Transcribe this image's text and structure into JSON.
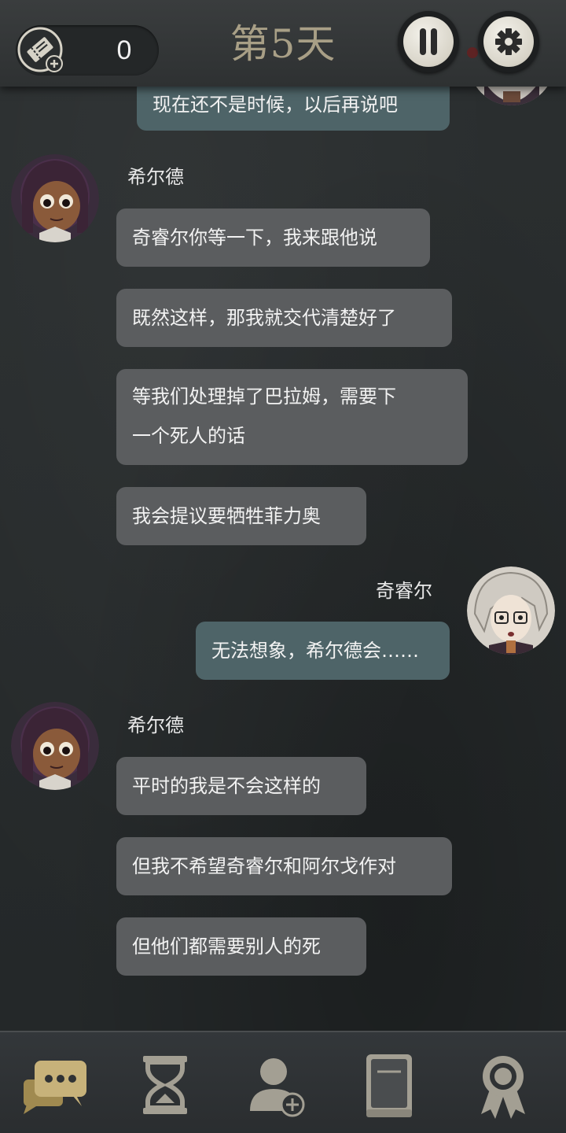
{
  "header": {
    "ticket_count": "0",
    "day_title": "第5天"
  },
  "messages": [
    {
      "speaker": "",
      "side": "right",
      "text": "现在还不是时候，以后再说吧"
    },
    {
      "speaker": "希尔德",
      "side": "left",
      "text": "奇睿尔你等一下，我来跟他说"
    },
    {
      "speaker": "",
      "side": "left",
      "text": "既然这样，那我就交代清楚好了"
    },
    {
      "speaker": "",
      "side": "left",
      "text": "等我们处理掉了巴拉姆，需要下\n一个死人的话"
    },
    {
      "speaker": "",
      "side": "left",
      "text": "我会提议要牺牲菲力奥"
    },
    {
      "speaker": "奇睿尔",
      "side": "right",
      "text": "无法想象，希尔德会……"
    },
    {
      "speaker": "希尔德",
      "side": "left",
      "text": "平时的我是不会这样的"
    },
    {
      "speaker": "",
      "side": "left",
      "text": "但我不希望奇睿尔和阿尔戈作对"
    },
    {
      "speaker": "",
      "side": "left",
      "text": "但他们都需要别人的死"
    }
  ],
  "nav": [
    {
      "icon": "chat-bubbles-icon",
      "active": true
    },
    {
      "icon": "hourglass-icon",
      "active": false
    },
    {
      "icon": "add-person-icon",
      "active": false
    },
    {
      "icon": "book-icon",
      "active": false
    },
    {
      "icon": "award-ribbon-icon",
      "active": false
    }
  ],
  "colors": {
    "nav_active": "#c7b27a",
    "nav_inactive": "#a39f93",
    "bubble_left": "#5b5d5f",
    "bubble_right": "#4e6468",
    "day_title": "#a89f86"
  }
}
